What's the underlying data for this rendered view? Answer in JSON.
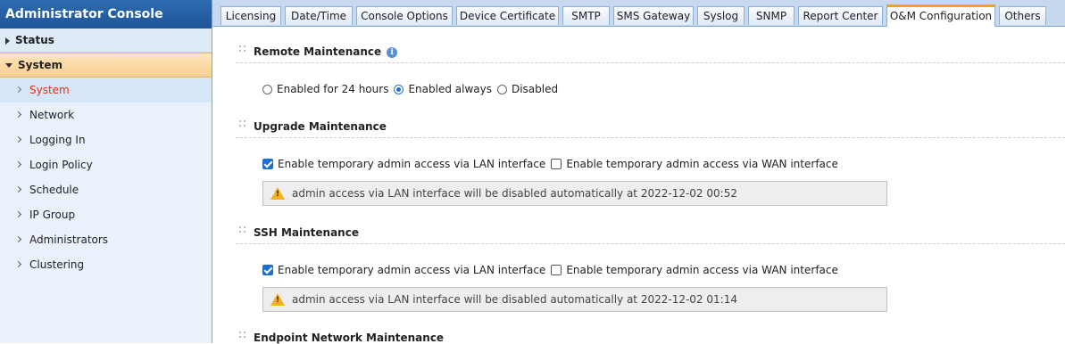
{
  "sidebar": {
    "title": "Administrator Console",
    "status_label": "Status",
    "system_label": "System",
    "items": [
      {
        "label": "System"
      },
      {
        "label": "Network"
      },
      {
        "label": "Logging In"
      },
      {
        "label": "Login Policy"
      },
      {
        "label": "Schedule"
      },
      {
        "label": "IP Group"
      },
      {
        "label": "Administrators"
      },
      {
        "label": "Clustering"
      }
    ]
  },
  "tabs": [
    {
      "label": "Licensing"
    },
    {
      "label": "Date/Time"
    },
    {
      "label": "Console Options"
    },
    {
      "label": "Device Certificate"
    },
    {
      "label": "SMTP"
    },
    {
      "label": "SMS Gateway"
    },
    {
      "label": "Syslog"
    },
    {
      "label": "SNMP"
    },
    {
      "label": "Report Center"
    },
    {
      "label": "O&M Configuration"
    },
    {
      "label": "Others"
    }
  ],
  "remote": {
    "title": "Remote Maintenance",
    "info_icon": "i",
    "options": [
      "Enabled for 24 hours",
      "Enabled always",
      "Disabled"
    ],
    "selected": "Enabled always"
  },
  "upgrade": {
    "title": "Upgrade Maintenance",
    "lan_label": "Enable temporary admin access via LAN interface",
    "wan_label": "Enable temporary admin access via WAN interface",
    "lan_checked": true,
    "wan_checked": false,
    "notice": "admin access via LAN interface will be disabled automatically at 2022-12-02 00:52"
  },
  "ssh": {
    "title": "SSH Maintenance",
    "lan_label": "Enable temporary admin access via LAN interface",
    "wan_label": "Enable temporary admin access via WAN interface",
    "lan_checked": true,
    "wan_checked": false,
    "notice": "admin access via LAN interface will be disabled automatically at 2022-12-02 01:14"
  },
  "endpoint": {
    "title": "Endpoint Network Maintenance"
  }
}
